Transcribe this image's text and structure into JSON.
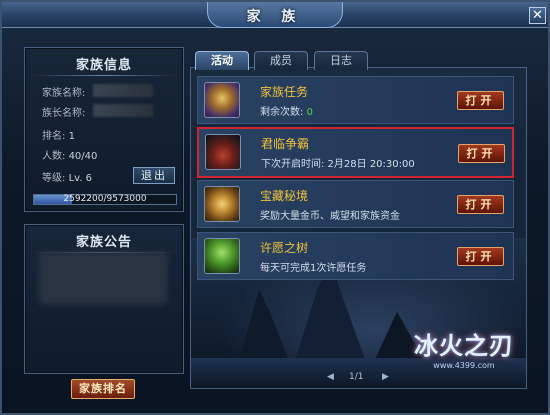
{
  "window": {
    "title": "家 族"
  },
  "left": {
    "info_title": "家族信息",
    "labels": {
      "family_name": "家族名称:",
      "leader_name": "族长名称:",
      "rank": "排名:",
      "members": "人数:",
      "level": "等级:"
    },
    "values": {
      "rank": "1",
      "members": "40/40",
      "level": "Lv. 6"
    },
    "quit_label": "退出",
    "progress": {
      "text": "2592200/9573000",
      "fraction": 0.27
    },
    "notice_title": "家族公告",
    "rank_button": "家族排名"
  },
  "tabs": [
    {
      "label": "活动",
      "active": true
    },
    {
      "label": "成员",
      "active": false
    },
    {
      "label": "日志",
      "active": false
    }
  ],
  "activities": [
    {
      "name": "家族任务",
      "desc_prefix": "剩余次数:",
      "desc_value": "0",
      "button": "打开",
      "icon": "scroll-icon",
      "highlight": false
    },
    {
      "name": "君临争霸",
      "desc_prefix": "下次开启时间: 2月28日 20:30:00",
      "desc_value": "",
      "button": "打开",
      "icon": "throne-icon",
      "highlight": true
    },
    {
      "name": "宝藏秘境",
      "desc_prefix": "奖励大量金币、威望和家族资金",
      "desc_value": "",
      "button": "打开",
      "icon": "treasure-chest-icon",
      "highlight": false
    },
    {
      "name": "许愿之树",
      "desc_prefix": "每天可完成1次许愿任务",
      "desc_value": "",
      "button": "打开",
      "icon": "wish-tree-icon",
      "highlight": false
    }
  ],
  "pager": {
    "text": "1/1"
  },
  "logo": {
    "title": "冰火之刃",
    "url": "www.4399.com"
  }
}
